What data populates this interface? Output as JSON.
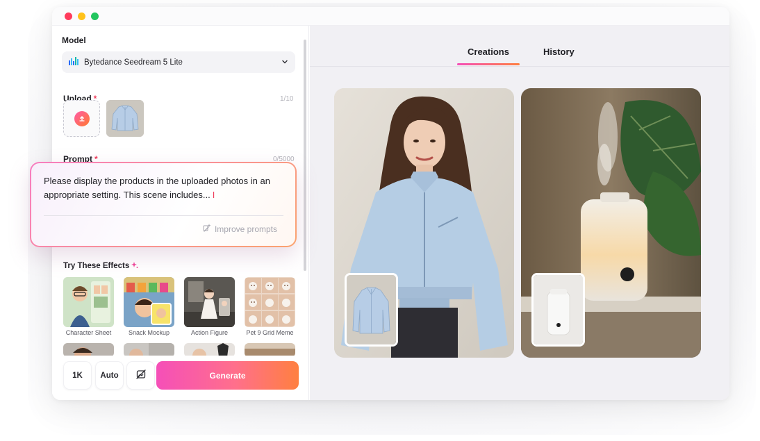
{
  "window": {
    "controls": [
      "close",
      "minimize",
      "maximize"
    ]
  },
  "left": {
    "model": {
      "label": "Model",
      "selected": "Bytedance Seedream 5 Lite"
    },
    "upload": {
      "label": "Upload",
      "required_mark": "*",
      "counter": "1/10"
    },
    "prompt": {
      "label": "Prompt",
      "required_mark": "*",
      "counter": "0/5000",
      "text": "Please display the products in the uploaded photos in an appropriate setting. This scene includes...",
      "improve_label": "Improve prompts"
    },
    "effects": {
      "label": "Try These Effects",
      "items": [
        {
          "caption": "Character Sheet"
        },
        {
          "caption": "Snack Mockup"
        },
        {
          "caption": "Action Figure"
        },
        {
          "caption": "Pet 9 Grid Meme"
        }
      ]
    },
    "controls": {
      "resolution": "1K",
      "aspect": "Auto",
      "generate": "Generate"
    }
  },
  "right": {
    "tabs": [
      {
        "label": "Creations",
        "active": true
      },
      {
        "label": "History",
        "active": false
      }
    ]
  },
  "colors": {
    "accent_start": "#f54fb8",
    "accent_end": "#ff8040",
    "required": "#ef3b5a"
  }
}
